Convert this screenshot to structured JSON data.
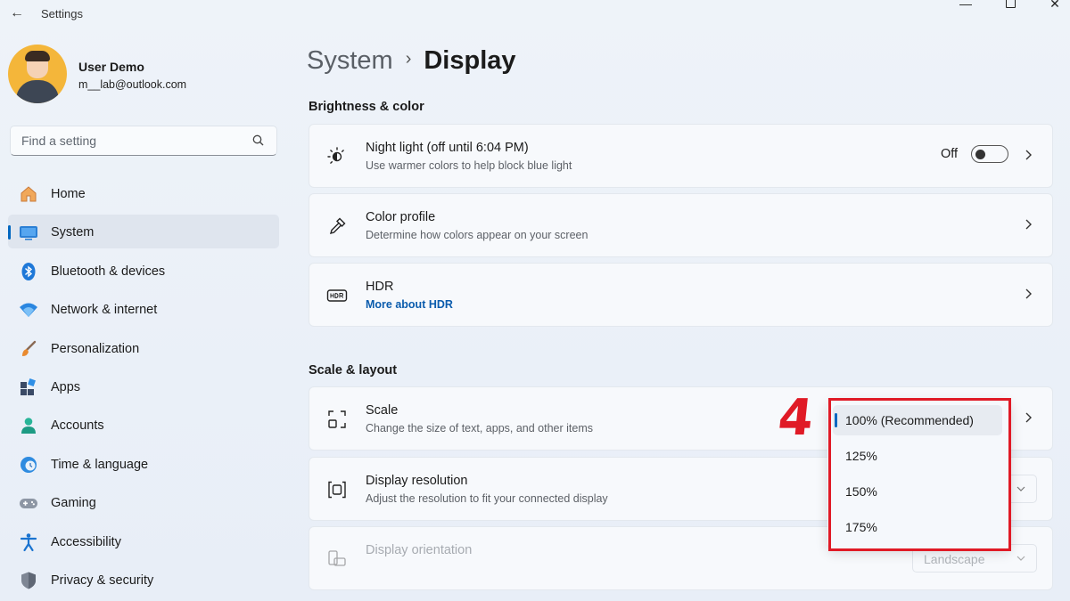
{
  "window": {
    "title": "Settings",
    "minimize": "—",
    "close": "✕"
  },
  "user": {
    "name": "User Demo",
    "email": "m__lab@outlook.com"
  },
  "search": {
    "placeholder": "Find a setting"
  },
  "nav": [
    {
      "label": "Home",
      "icon": "home-icon"
    },
    {
      "label": "System",
      "icon": "monitor-icon",
      "active": true
    },
    {
      "label": "Bluetooth & devices",
      "icon": "bluetooth-icon"
    },
    {
      "label": "Network & internet",
      "icon": "wifi-icon"
    },
    {
      "label": "Personalization",
      "icon": "brush-icon"
    },
    {
      "label": "Apps",
      "icon": "apps-icon"
    },
    {
      "label": "Accounts",
      "icon": "person-icon"
    },
    {
      "label": "Time & language",
      "icon": "clock-globe-icon"
    },
    {
      "label": "Gaming",
      "icon": "gamepad-icon"
    },
    {
      "label": "Accessibility",
      "icon": "accessibility-icon"
    },
    {
      "label": "Privacy & security",
      "icon": "shield-icon"
    }
  ],
  "breadcrumb": {
    "parent": "System",
    "separator": "›",
    "current": "Display"
  },
  "sections": {
    "brightness": {
      "title": "Brightness & color"
    },
    "scale": {
      "title": "Scale & layout"
    }
  },
  "cards": {
    "night_light": {
      "title": "Night light (off until 6:04 PM)",
      "subtitle": "Use warmer colors to help block blue light",
      "toggle_label": "Off",
      "toggle_on": false
    },
    "color_profile": {
      "title": "Color profile",
      "subtitle": "Determine how colors appear on your screen"
    },
    "hdr": {
      "title": "HDR",
      "link": "More about HDR"
    },
    "scale": {
      "title": "Scale",
      "subtitle": "Change the size of text, apps, and other items"
    },
    "resolution": {
      "title": "Display resolution",
      "subtitle": "Adjust the resolution to fit your connected display"
    },
    "orientation": {
      "title": "Display orientation",
      "value": "Landscape"
    }
  },
  "scale_dropdown": {
    "options": [
      "100% (Recommended)",
      "125%",
      "150%",
      "175%"
    ],
    "selected": "100% (Recommended)"
  },
  "annotation": {
    "step": "4",
    "color": "#e01a26"
  },
  "colors": {
    "accent": "#0067c0",
    "link": "#0b5cad"
  }
}
